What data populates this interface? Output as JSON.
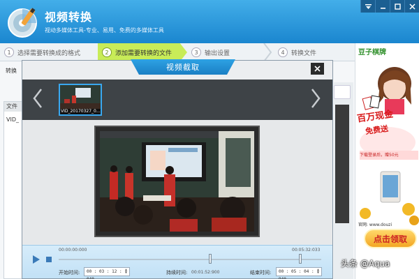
{
  "app": {
    "title": "视频转换",
    "subtitle": "视动多媒体工具-专业、易用、免费的多媒体工具"
  },
  "steps": [
    {
      "num": "1",
      "label": "选择需要转换成的格式",
      "active": false
    },
    {
      "num": "2",
      "label": "添加需要转换的文件",
      "active": true
    },
    {
      "num": "3",
      "label": "输出设置",
      "active": false
    },
    {
      "num": "4",
      "label": "转换文件",
      "active": false
    }
  ],
  "background": {
    "tab_label": "转换",
    "list_header": "文件",
    "list_row": "VID_"
  },
  "dialog": {
    "title": "视频截取",
    "thumbnail_label": "VID_20170327_0..."
  },
  "controls": {
    "timeline_start": "00:00:00:000",
    "timeline_end": "00:05:32:033",
    "start_label": "开始时间:",
    "start_value": "00 : 03 : 12 : 040",
    "duration_label": "持续时间:",
    "duration_value": "00:01:52:900",
    "end_label": "结束时间:",
    "end_value": "00 : 05 : 04 : 940"
  },
  "ad": {
    "brand": "豆子棋牌",
    "promo_line1": "百万现金",
    "promo_line2": "免费送",
    "strip_text": "下载登录后，赠50元",
    "url": "官网: www.douzi",
    "cta": "点击领取"
  },
  "watermark": "头条 @Aqua",
  "colors": {
    "header_blue": "#1a86cf",
    "active_step": "#c8ec58",
    "thumb_border": "#39a8f0",
    "ad_red": "#d81b1b"
  }
}
